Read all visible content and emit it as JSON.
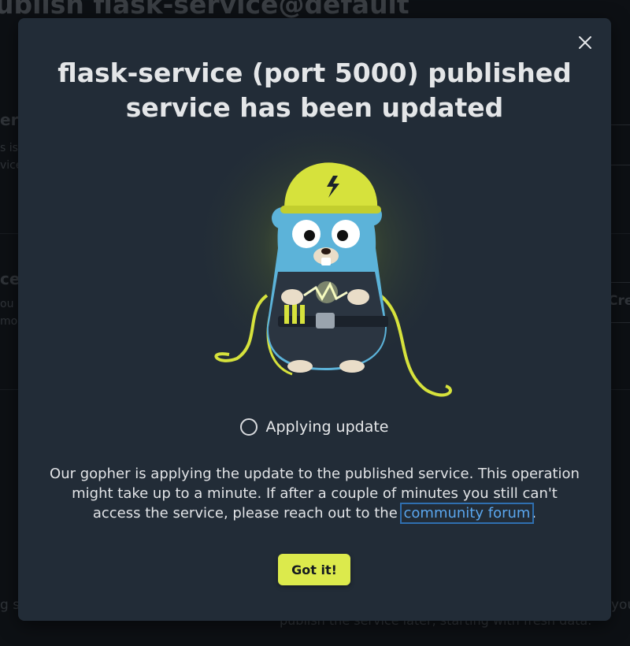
{
  "background": {
    "page_title": "ublish flask-service@default",
    "frag_1": "erv",
    "frag_2": "s is",
    "frag_3": "vice",
    "frag_4": "ce",
    "frag_5": "ou",
    "frag_6": "mor",
    "frag_7": "Cre",
    "frag_8": "g s",
    "frag_9": "publish the service later, starting with fresh data.",
    "frag_10": "you"
  },
  "modal": {
    "title": "flask-service (port 5000) published service has been updated",
    "status_text": "Applying update",
    "description_prefix": "Our gopher is applying the update to the published service. This operation might take up to a minute. If after a couple of minutes you still can't access the service, please reach out to the ",
    "link_text": "community forum",
    "description_suffix": ".",
    "confirm_button": "Got it!"
  },
  "colors": {
    "accent": "#dcea4c",
    "link": "#5aa6ee",
    "modal_bg": "#222c37"
  },
  "icons": {
    "close": "close-icon",
    "spinner": "spinner-icon"
  }
}
